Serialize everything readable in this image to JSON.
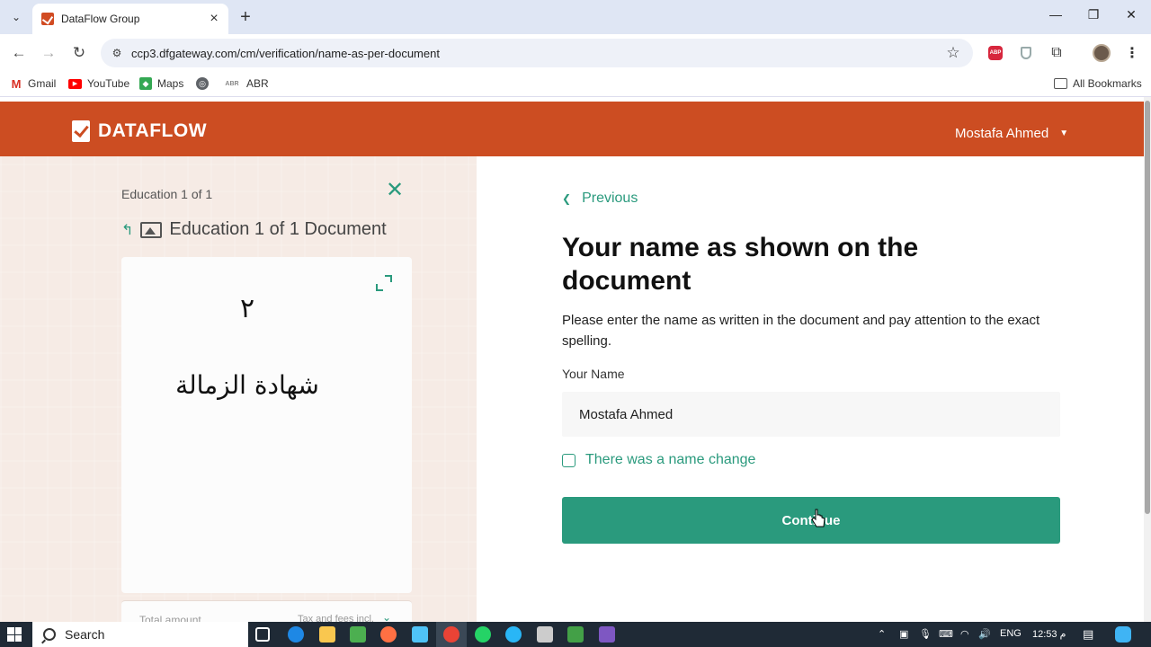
{
  "browser": {
    "tab_title": "DataFlow Group",
    "url": "ccp3.dfgateway.com/cm/verification/name-as-per-document",
    "bookmarks": [
      {
        "label": "Gmail",
        "icon": "gmail-icon",
        "color": "#d93025"
      },
      {
        "label": "YouTube",
        "icon": "youtube-icon",
        "color": "#ff0000"
      },
      {
        "label": "Maps",
        "icon": "maps-icon",
        "color": "#34a853"
      },
      {
        "label": "",
        "icon": "globe-icon",
        "color": "#5f6368"
      },
      {
        "label": "ABR",
        "icon": "abr-icon",
        "color": "#5f6368"
      }
    ],
    "all_bookmarks": "All Bookmarks"
  },
  "header": {
    "brand": "DATAFLOW",
    "user_name": "Mostafa Ahmed",
    "brand_color": "#cc4d22"
  },
  "left": {
    "education_label": "Education 1 of 1",
    "document_title": "Education 1 of 1 Document",
    "doc_number": "٢",
    "doc_heading": "شهادة الزمالة",
    "total_label": "Total amount",
    "tax_label": "Tax and fees incl."
  },
  "right": {
    "previous": "Previous",
    "heading": "Your name as shown on the document",
    "instructions": "Please enter the name as written in the document and pay attention to the exact spelling.",
    "field_label": "Your Name",
    "name_value": "Mostafa Ahmed",
    "name_change_label": "There was a name change",
    "continue": "Continue",
    "accent_color": "#2a9a7d"
  },
  "taskbar": {
    "search": "Search",
    "lang": "ENG",
    "time": "12:53 م"
  }
}
